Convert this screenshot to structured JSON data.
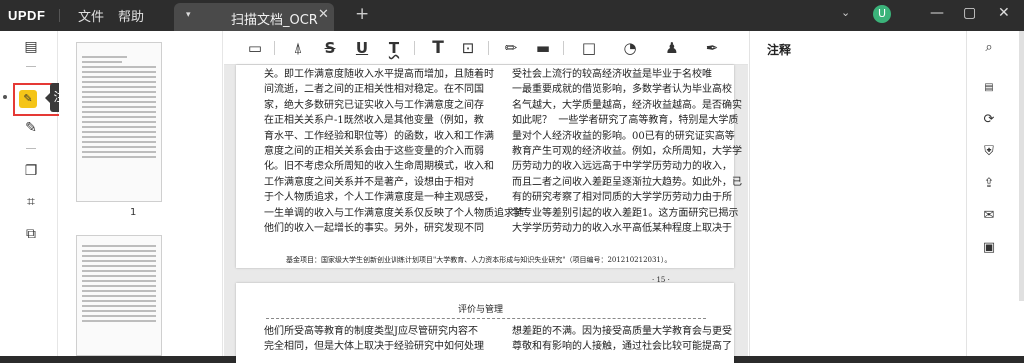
{
  "titlebar": {
    "logo": "UPDF",
    "menu_file": "文件",
    "menu_help": "帮助",
    "tab_arrow": "▾",
    "tab_name": "扫描文档_OCR",
    "tab_close": "✕",
    "new_tab": "+",
    "user_menu": "⌄",
    "avatar": "U",
    "minimize": "—",
    "maximize": "▢",
    "close": "✕"
  },
  "leftbar": {
    "tooltip": "注释"
  },
  "thumbnails": {
    "page_number": "1"
  },
  "toolbar": {
    "icons": [
      "comment-icon",
      "highlight-icon",
      "strikethrough-icon",
      "underline-icon",
      "squiggly-icon",
      "text-icon",
      "textbox-icon",
      "pencil-icon",
      "eraser-icon",
      "shape-icon",
      "sticker-icon",
      "stamp-icon",
      "signature-icon"
    ],
    "labels": {
      "strike": "S",
      "underline": "U",
      "squiggly": "T",
      "text": "T"
    }
  },
  "right_panel": {
    "title": "注释"
  },
  "page1": {
    "left_col": [
      "关。即工作满意度随收入水平提高而增加，且随着时",
      "间流逝，二者之间的正相关性相对稳定。在不同国",
      "家，绝大多数研究已证实收入与工作满意度之间存",
      "在正相关关系户-1既然收入是其他变量（例如，教",
      "育水平、工作经验和职位等）的函数，收入和工作满",
      "意度之间的正相关关系会由于这些变量的介入而弱",
      "化。旧不考虑众所周知的收入生命周期模式，收入和",
      "工作满意度之间关系并不是著产，设想由于相对",
      "于个人物质追求，个人工作满意度是一种主观感受，",
      "一生单调的收入与工作满意度关系仅反映了个人物质追求随",
      "他们的收入一起增长的事实。另外，研究发现不同"
    ],
    "right_col": [
      "受社会上流行的较高经济收益是毕业于名校唯",
      "一最重要成就的借览影响，多数学者认为毕业高校",
      "名气越大，大学质量越高，经济收益越高。是否确实",
      "如此呢？  一些学者研究了高等教育，特别是大学质",
      "量对个人经济收益的影响。00已有的研究证实高等",
      "教育产生可观的经济收益。例如，众所周知，大学学",
      "历劳动力的收入远远高于中学学历劳动力的收入，",
      "而且二者之间收入差距呈逐渐拉大趋势。如此外，已",
      "有的研究考察了相对同质的大学学历劳动力由于所",
      "学专业等差别引起的收入差距1。这方面研究已揭示",
      "大学学历劳动力的收入水平高低某种程度上取决于"
    ],
    "footnote": "基金项目：国家级大学生创新创业训练计划项目\"大学教育、人力资本形成与知识失业研究\"（项目编号：201210212031）。",
    "page_num": "· 15 ·"
  },
  "page2": {
    "header": "评价与管理",
    "left_col": [
      "他们所受高等教育的制度类型J应尽管研究内容不",
      "完全相同，但是大体上取决于经验研究中如何处理"
    ],
    "right_col": [
      "想差距的不满。因为接受高质量大学教育会与更受",
      "尊敬和有影响的人接触，通过社会比较可能提高了"
    ]
  }
}
